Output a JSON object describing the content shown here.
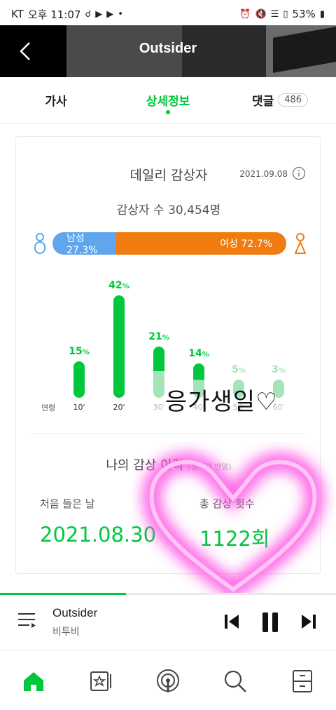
{
  "status_bar": {
    "carrier": "KT",
    "time": "오후 11:07",
    "battery": "53%"
  },
  "header": {
    "title": "Outsider"
  },
  "tabs": [
    {
      "label": "가사",
      "active": false
    },
    {
      "label": "상세정보",
      "active": true
    },
    {
      "label": "댓글",
      "badge": "486",
      "active": false
    }
  ],
  "daily": {
    "title": "데일리 감상자",
    "date": "2021.09.08",
    "listener_count": "감상자 수 30,454명"
  },
  "gender": {
    "male_label": "남성 27.3%",
    "female_label": "여성 72.7%",
    "male_pct": 27.3,
    "female_pct": 72.7,
    "male_color": "#5fa6ee",
    "female_color": "#f07c10"
  },
  "chart_data": {
    "type": "bar",
    "xlabel": "연령",
    "categories": [
      "10'",
      "20'",
      "30'",
      "40'",
      "50'",
      "60'"
    ],
    "values": [
      15,
      42,
      21,
      14,
      5,
      3
    ],
    "value_labels": [
      "15",
      "42",
      "21",
      "14",
      "5",
      "3"
    ],
    "unit": "%",
    "color": "#00c73c"
  },
  "history": {
    "title": "나의 감상 이력",
    "subtitle": "(실시간 반영)",
    "first_label": "처음 들은 날",
    "first_value": "2021.08.30",
    "total_label": "총 감상 횟수",
    "total_value": "1122회"
  },
  "decoration": {
    "handwriting": "응가생일♡"
  },
  "player": {
    "title": "Outsider",
    "artist": "비투비",
    "progress": 0.375
  },
  "nav": {
    "items": [
      "home-icon",
      "my-music-icon",
      "podcast-icon",
      "search-icon",
      "storage-icon"
    ]
  }
}
